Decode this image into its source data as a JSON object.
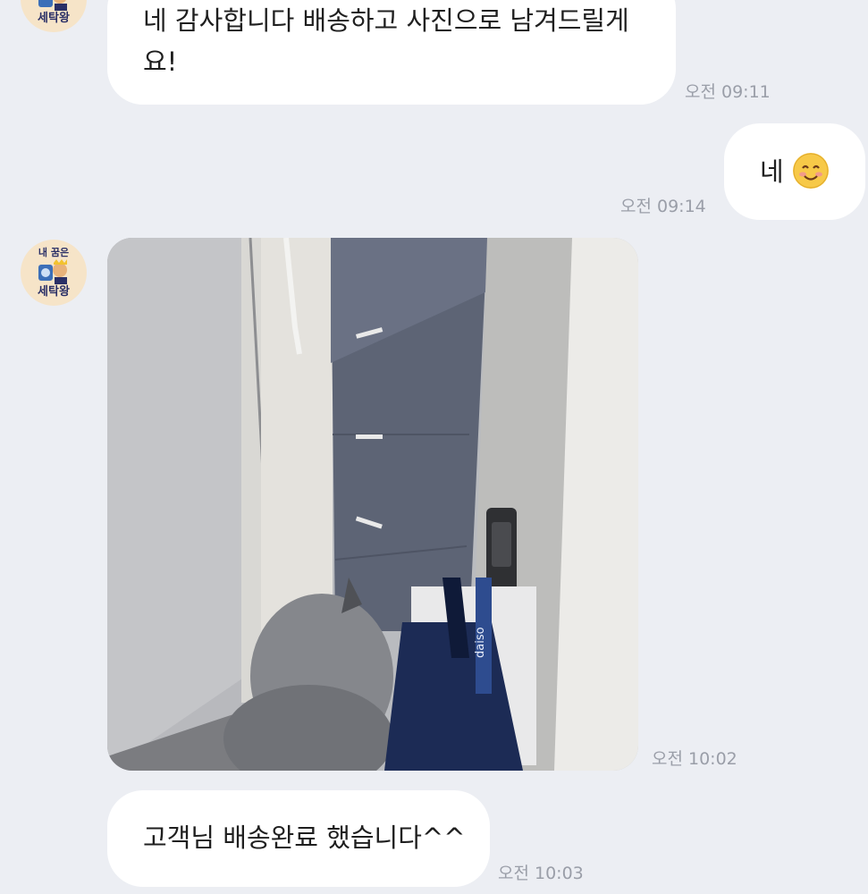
{
  "avatar": {
    "label_top": "내 꿈은",
    "label_bottom": "세탁왕"
  },
  "messages": [
    {
      "text": "네 감사합니다 배송하고 사진으로 남겨드릴게요!",
      "time": "오전 09:11"
    },
    {
      "text": "네",
      "time": "오전 09:14",
      "emoji": "smiling-face"
    },
    {
      "time": "오전 10:02",
      "photo_text": "daiso"
    },
    {
      "text": "고객님 배송완료 했습니다^^",
      "time": "오전 10:03"
    }
  ]
}
